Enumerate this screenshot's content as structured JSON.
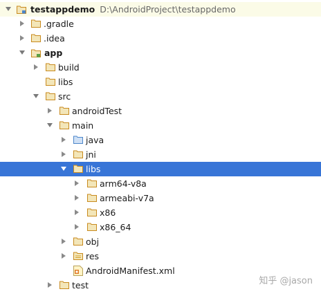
{
  "tree": {
    "root": {
      "name": "testappdemo",
      "path": "D:\\AndroidProject\\testappdemo"
    },
    "gradle": ".gradle",
    "idea": ".idea",
    "app": "app",
    "build": "build",
    "libs_app": "libs",
    "src": "src",
    "android_test": "androidTest",
    "main": "main",
    "java": "java",
    "jni": "jni",
    "libs_main": "libs",
    "arm64": "arm64-v8a",
    "armeabi": "armeabi-v7a",
    "x86": "x86",
    "x86_64": "x86_64",
    "obj": "obj",
    "res": "res",
    "manifest": "AndroidManifest.xml",
    "test": "test"
  },
  "watermark": "知乎 @jason",
  "colors": {
    "selection": "#3875d7",
    "root_highlight": "#fbfbe7",
    "folder_outline": "#c88a1e",
    "source_folder": "#4c86c9"
  }
}
